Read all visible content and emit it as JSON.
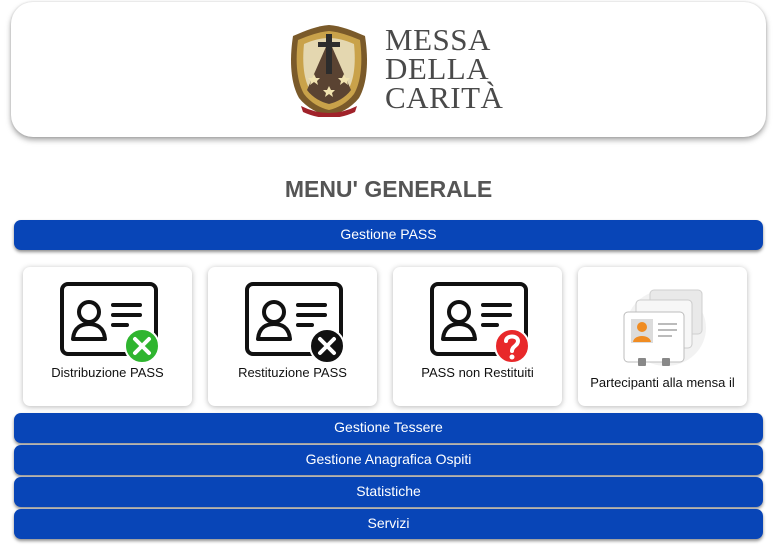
{
  "header": {
    "logo_lines": [
      "MESSA",
      "DELLA",
      "CARITÀ"
    ]
  },
  "title": "MENU' GENERALE",
  "menu": {
    "pass": "Gestione PASS",
    "tessere": "Gestione Tessere",
    "anagrafica": "Gestione Anagrafica Ospiti",
    "statistiche": "Statistiche",
    "servizi": "Servizi"
  },
  "tiles": [
    {
      "label": "Distribuzione PASS",
      "icon": "id-card-green-x-icon",
      "badge_color": "#2fb52f"
    },
    {
      "label": "Restituzione PASS",
      "icon": "id-card-black-x-icon",
      "badge_color": "#111111"
    },
    {
      "label": "PASS non Restituiti",
      "icon": "id-card-question-icon",
      "badge_color": "#e8282a"
    },
    {
      "label": "Partecipanti alla mensa il",
      "icon": "contact-cards-icon"
    }
  ],
  "colors": {
    "menu_bar": "#0845b7",
    "title": "#555555"
  }
}
